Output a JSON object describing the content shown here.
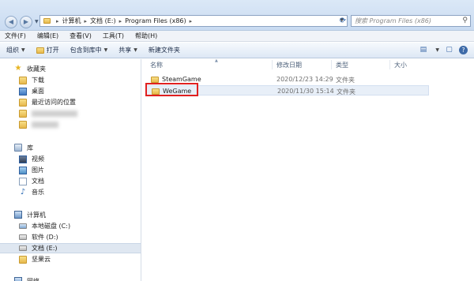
{
  "address_bar": {
    "path": [
      "计算机",
      "文档 (E:)",
      "Program Files (x86)"
    ],
    "search_placeholder": "搜索 Program Files (x86)"
  },
  "menu": [
    "文件(F)",
    "编辑(E)",
    "查看(V)",
    "工具(T)",
    "帮助(H)"
  ],
  "toolbar": {
    "organize": "组织",
    "open": "打开",
    "include_in_library": "包含到库中",
    "share": "共享",
    "new_folder": "新建文件夹"
  },
  "sidebar": {
    "favorites": {
      "label": "收藏夹",
      "items": [
        "下载",
        "桌面",
        "最近访问的位置"
      ]
    },
    "libraries": {
      "label": "库",
      "items": [
        "视频",
        "图片",
        "文档",
        "音乐"
      ]
    },
    "computer": {
      "label": "计算机",
      "items": [
        "本地磁盘 (C:)",
        "软件 (D:)",
        "文档 (E:)",
        "坚果云"
      ]
    },
    "network": {
      "label": "网络"
    }
  },
  "columns": {
    "name": "名称",
    "modified": "修改日期",
    "type": "类型",
    "size": "大小"
  },
  "files": [
    {
      "name": "SteamGame",
      "modified": "2020/12/23 14:29",
      "type": "文件夹"
    },
    {
      "name": "WeGame",
      "modified": "2020/11/30 15:14",
      "type": "文件夹"
    }
  ],
  "colors": {
    "highlight": "#e02020",
    "folder": "#e6b84c",
    "selection": "#dfe7f1"
  }
}
